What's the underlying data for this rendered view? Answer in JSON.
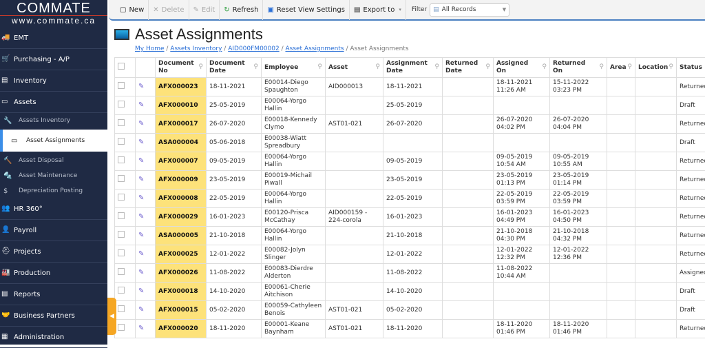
{
  "logo": {
    "name": "COMMATE",
    "url": "www.commate.ca"
  },
  "sidebar": {
    "items": [
      {
        "label": "EMT",
        "icon": "truck-icon"
      },
      {
        "label": "Purchasing - A/P",
        "icon": "cart-icon"
      },
      {
        "label": "Inventory",
        "icon": "inventory-icon"
      },
      {
        "label": "Assets",
        "icon": "monitor-icon"
      }
    ],
    "sub": [
      {
        "label": "Assets Inventory"
      },
      {
        "label": "Asset Assignments"
      },
      {
        "label": "Asset Disposal"
      },
      {
        "label": "Asset Maintenance"
      },
      {
        "label": "Depreciation Posting"
      }
    ],
    "items2": [
      {
        "label": "HR 360°"
      },
      {
        "label": "Payroll"
      },
      {
        "label": "Projects"
      },
      {
        "label": "Production"
      },
      {
        "label": "Reports"
      },
      {
        "label": "Business Partners"
      },
      {
        "label": "Administration"
      }
    ]
  },
  "toolbar": {
    "new": "New",
    "delete": "Delete",
    "edit": "Edit",
    "refresh": "Refresh",
    "reset": "Reset View Settings",
    "export": "Export to",
    "filter_label": "Filter",
    "filter_value": "All Records"
  },
  "page": {
    "title": "Asset Assignments",
    "breadcrumb": [
      "My Home",
      "Assets Inventory",
      "AID000FM00002",
      "Asset Assignments",
      "Asset Assignments"
    ]
  },
  "table": {
    "columns": [
      "Document No",
      "Document Date",
      "Employee",
      "Asset",
      "Assignment Date",
      "Returned Date",
      "Assigned On",
      "Returned On",
      "Area",
      "Location",
      "Status"
    ],
    "rows": [
      [
        "AFX000023",
        "18-11-2021",
        "E00014-Diego Spaughton",
        "AID000013",
        "18-11-2021",
        "",
        "18-11-2021 11:26 AM",
        "15-11-2022 03:23 PM",
        "",
        "",
        "Returned"
      ],
      [
        "AFX000010",
        "25-05-2019",
        "E00064-Yorgo Hallin",
        "",
        "25-05-2019",
        "",
        "",
        "",
        "",
        "",
        "Draft"
      ],
      [
        "AFX000017",
        "26-07-2020",
        "E00018-Kennedy Clymo",
        "AST01-021",
        "26-07-2020",
        "",
        "26-07-2020 04:02 PM",
        "26-07-2020 04:04 PM",
        "",
        "",
        "Returned"
      ],
      [
        "ASA000004",
        "05-06-2018",
        "E00038-Wiatt Spreadbury",
        "",
        "",
        "",
        "",
        "",
        "",
        "",
        "Draft"
      ],
      [
        "AFX000007",
        "09-05-2019",
        "E00064-Yorgo Hallin",
        "",
        "09-05-2019",
        "",
        "09-05-2019 10:54 AM",
        "09-05-2019 10:55 AM",
        "",
        "",
        "Returned"
      ],
      [
        "AFX000009",
        "23-05-2019",
        "E00019-Michail Piwall",
        "",
        "23-05-2019",
        "",
        "23-05-2019 01:13 PM",
        "23-05-2019 01:14 PM",
        "",
        "",
        "Returned"
      ],
      [
        "AFX000008",
        "22-05-2019",
        "E00064-Yorgo Hallin",
        "",
        "22-05-2019",
        "",
        "22-05-2019 03:59 PM",
        "22-05-2019 03:59 PM",
        "",
        "",
        "Returned"
      ],
      [
        "AFX000029",
        "16-01-2023",
        "E00120-Prisca McCathay",
        "AID000159 - 224-corola",
        "16-01-2023",
        "",
        "16-01-2023 04:49 PM",
        "16-01-2023 04:50 PM",
        "",
        "",
        "Returned"
      ],
      [
        "ASA000005",
        "21-10-2018",
        "E00064-Yorgo Hallin",
        "",
        "21-10-2018",
        "",
        "21-10-2018 04:30 PM",
        "21-10-2018 04:32 PM",
        "",
        "",
        "Returned"
      ],
      [
        "AFX000025",
        "12-01-2022",
        "E00082-Jolyn Slinger",
        "",
        "12-01-2022",
        "",
        "12-01-2022 12:32 PM",
        "12-01-2022 12:36 PM",
        "",
        "",
        "Returned"
      ],
      [
        "AFX000026",
        "11-08-2022",
        "E00083-Dierdre Alderton",
        "",
        "11-08-2022",
        "",
        "11-08-2022 10:44 AM",
        "",
        "",
        "",
        "Assigned"
      ],
      [
        "AFX000018",
        "14-10-2020",
        "E00061-Cherie Aitchison",
        "",
        "14-10-2020",
        "",
        "",
        "",
        "",
        "",
        "Draft"
      ],
      [
        "AFX000015",
        "05-02-2020",
        "E00059-Cathyleen Benois",
        "AST01-021",
        "05-02-2020",
        "",
        "",
        "",
        "",
        "",
        "Draft"
      ],
      [
        "AFX000020",
        "18-11-2020",
        "E00001-Keane Baynham",
        "AST01-021",
        "18-11-2020",
        "",
        "18-11-2020 01:46 PM",
        "18-11-2020 01:46 PM",
        "",
        "",
        "Returned"
      ]
    ]
  }
}
